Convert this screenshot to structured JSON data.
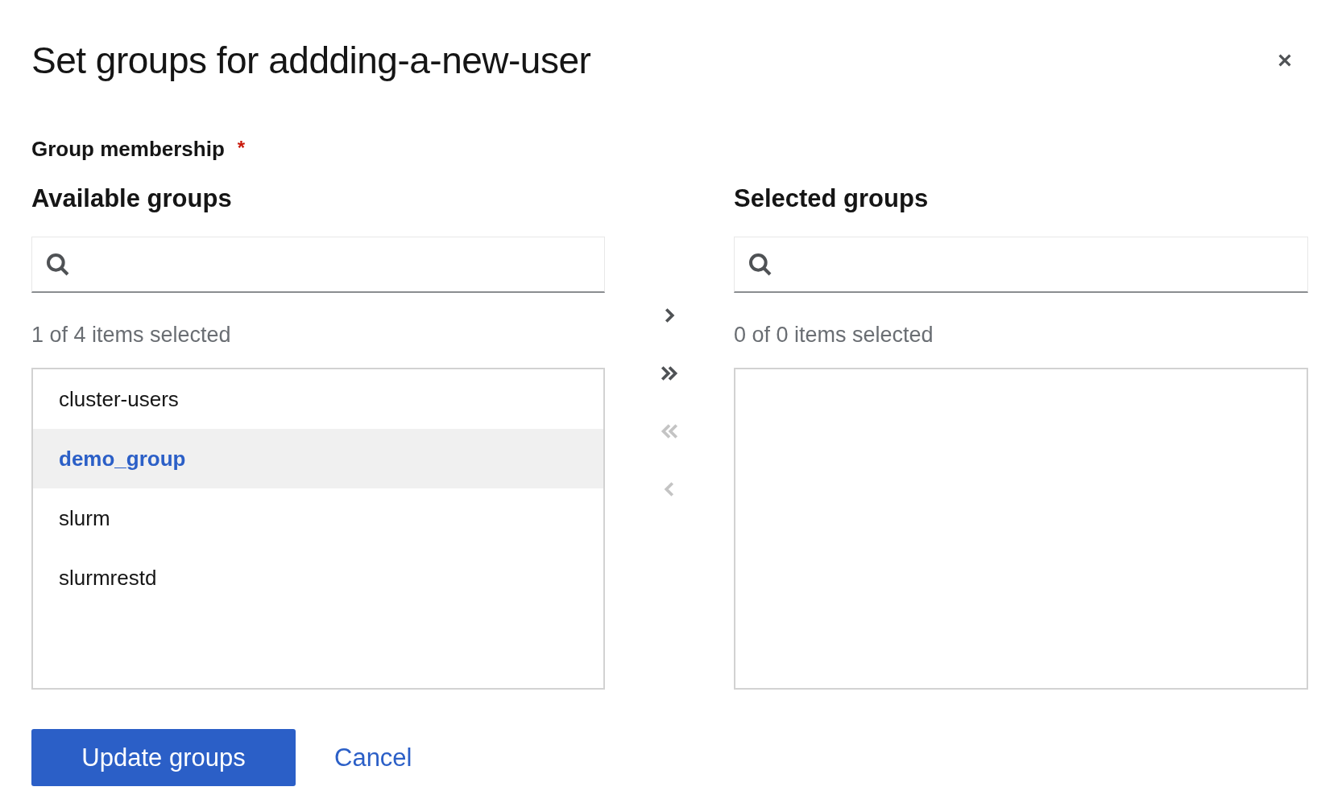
{
  "dialog": {
    "title": "Set groups for addding-a-new-user"
  },
  "field": {
    "label": "Group membership",
    "required_mark": "*"
  },
  "available": {
    "heading": "Available groups",
    "status": "1 of 4 items selected",
    "items": [
      {
        "label": "cluster-users",
        "selected": false
      },
      {
        "label": "demo_group",
        "selected": true
      },
      {
        "label": "slurm",
        "selected": false
      },
      {
        "label": "slurmrestd",
        "selected": false
      }
    ]
  },
  "controls": [
    {
      "kind": "add",
      "disabled": false
    },
    {
      "kind": "add_all",
      "disabled": false
    },
    {
      "kind": "remove_all",
      "disabled": true
    },
    {
      "kind": "remove",
      "disabled": true
    }
  ],
  "chosen": {
    "heading": "Selected groups",
    "status": "0 of 0 items selected"
  },
  "buttons": [
    {
      "label": "Update groups",
      "kind": "primary"
    },
    {
      "label": "Cancel",
      "kind": "link"
    }
  ]
}
